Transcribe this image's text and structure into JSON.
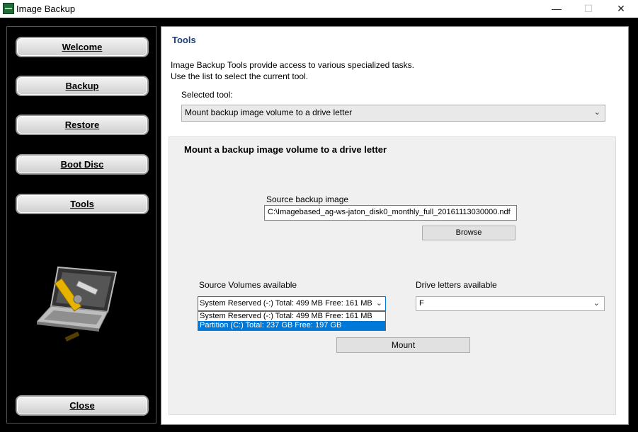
{
  "window": {
    "title": "Image Backup",
    "minimize": "—",
    "maximize": "☐",
    "close": "✕"
  },
  "sidebar": {
    "buttons": [
      "Welcome",
      "Backup",
      "Restore",
      "Boot Disc",
      "Tools"
    ],
    "close_label": "Close"
  },
  "main": {
    "title": "Tools",
    "description_line1": "Image Backup Tools provide access to various specialized tasks.",
    "description_line2": "Use the list to select the current tool.",
    "selected_tool_label": "Selected tool:",
    "selected_tool_value": "Mount backup image volume to a drive letter",
    "panel": {
      "title": "Mount a backup image volume to a drive letter",
      "source_image_label": "Source backup image",
      "source_image_value": "C:\\Imagebased_ag-ws-jaton_disk0_monthly_full_20161113030000.ndf",
      "browse_label": "Browse",
      "source_volumes_label": "Source Volumes available",
      "source_volume_selected": "System Reserved (-:) Total: 499 MB  Free: 161 MB",
      "source_volume_options": [
        "System Reserved (-:) Total: 499 MB  Free: 161 MB",
        "Partition (C:) Total: 237 GB  Free: 197 GB"
      ],
      "drive_letters_label": "Drive letters available",
      "drive_letter_value": "F",
      "mount_label": "Mount"
    }
  },
  "icons": {
    "chevron": "⌄"
  }
}
